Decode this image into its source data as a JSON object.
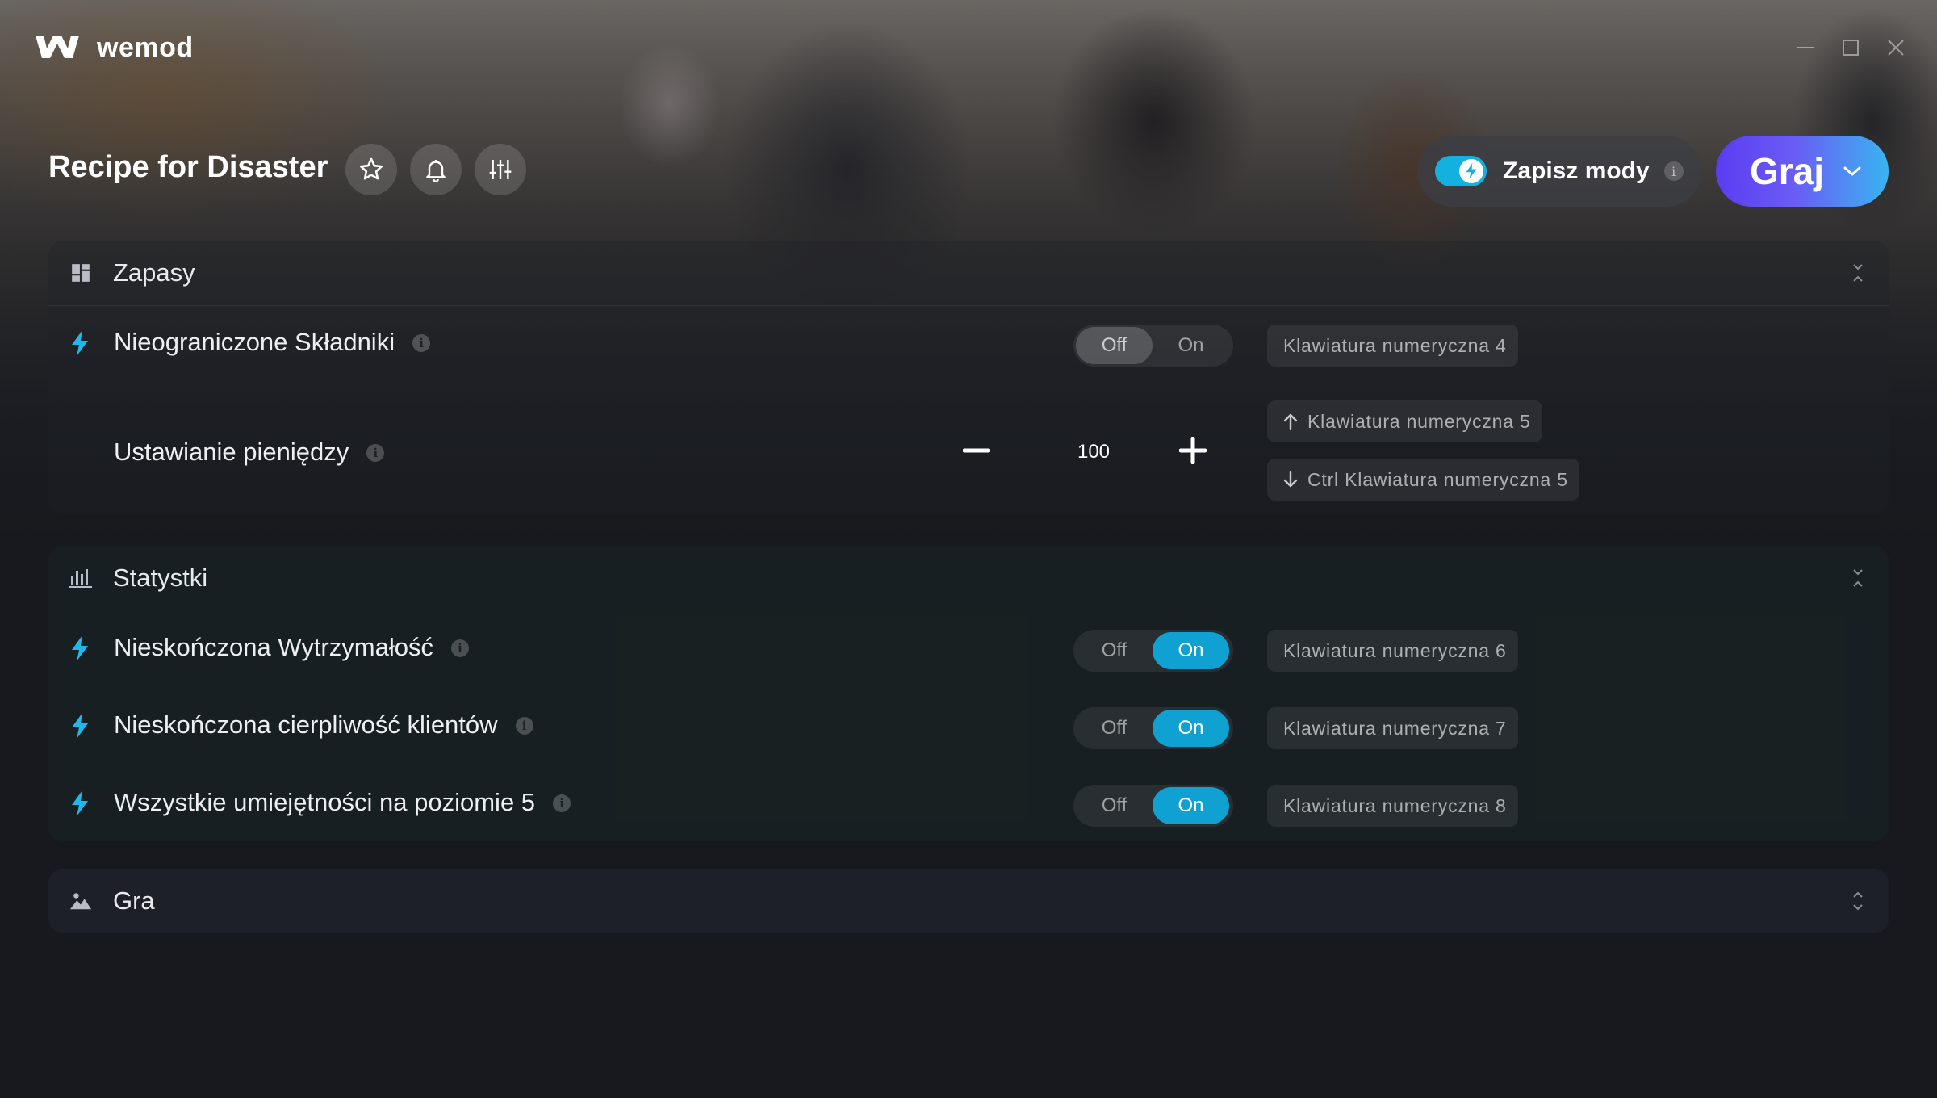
{
  "app": {
    "brand": "wemod",
    "window_controls": [
      "minimize-icon",
      "maximize-icon",
      "close-icon"
    ]
  },
  "header": {
    "game_title": "Recipe for Disaster",
    "icon_buttons": [
      "star-icon",
      "bell-icon",
      "sliders-icon"
    ],
    "save_mods": {
      "label": "Zapisz mody",
      "enabled": true,
      "info": "i"
    },
    "play": {
      "label": "Graj"
    }
  },
  "sections": [
    {
      "title": "Zapasy",
      "icon": "dashboard-icon",
      "rows": [
        {
          "label": "Nieograniczone Składniki",
          "type": "toggle",
          "off_label": "Off",
          "on_label": "On",
          "state": "off",
          "hotkey": "Klawiatura numeryczna 4"
        },
        {
          "label": "Ustawianie pieniędzy",
          "type": "stepper",
          "value": "100",
          "hotkey_up": "Klawiatura numeryczna 5",
          "hotkey_down": "Ctrl Klawiatura numeryczna 5"
        }
      ]
    },
    {
      "title": "Statystki",
      "icon": "bar-chart-icon",
      "rows": [
        {
          "label": "Nieskończona Wytrzymałość",
          "off_label": "Off",
          "on_label": "On",
          "state": "on",
          "hotkey": "Klawiatura numeryczna 6"
        },
        {
          "label": "Nieskończona cierpliwość klientów",
          "off_label": "Off",
          "on_label": "On",
          "state": "on",
          "hotkey": "Klawiatura numeryczna 7"
        },
        {
          "label": "Wszystkie umiejętności na poziomie 5",
          "off_label": "Off",
          "on_label": "On",
          "state": "on",
          "hotkey": "Klawiatura numeryczna 8"
        }
      ]
    },
    {
      "title": "Gra",
      "icon": "landscape-icon",
      "rows": []
    }
  ],
  "colors": {
    "accent": "#0ea1d1",
    "play_gradient_start": "#5b3cf2",
    "play_gradient_end": "#39b4f1",
    "bolt": "#1fb8ea"
  }
}
